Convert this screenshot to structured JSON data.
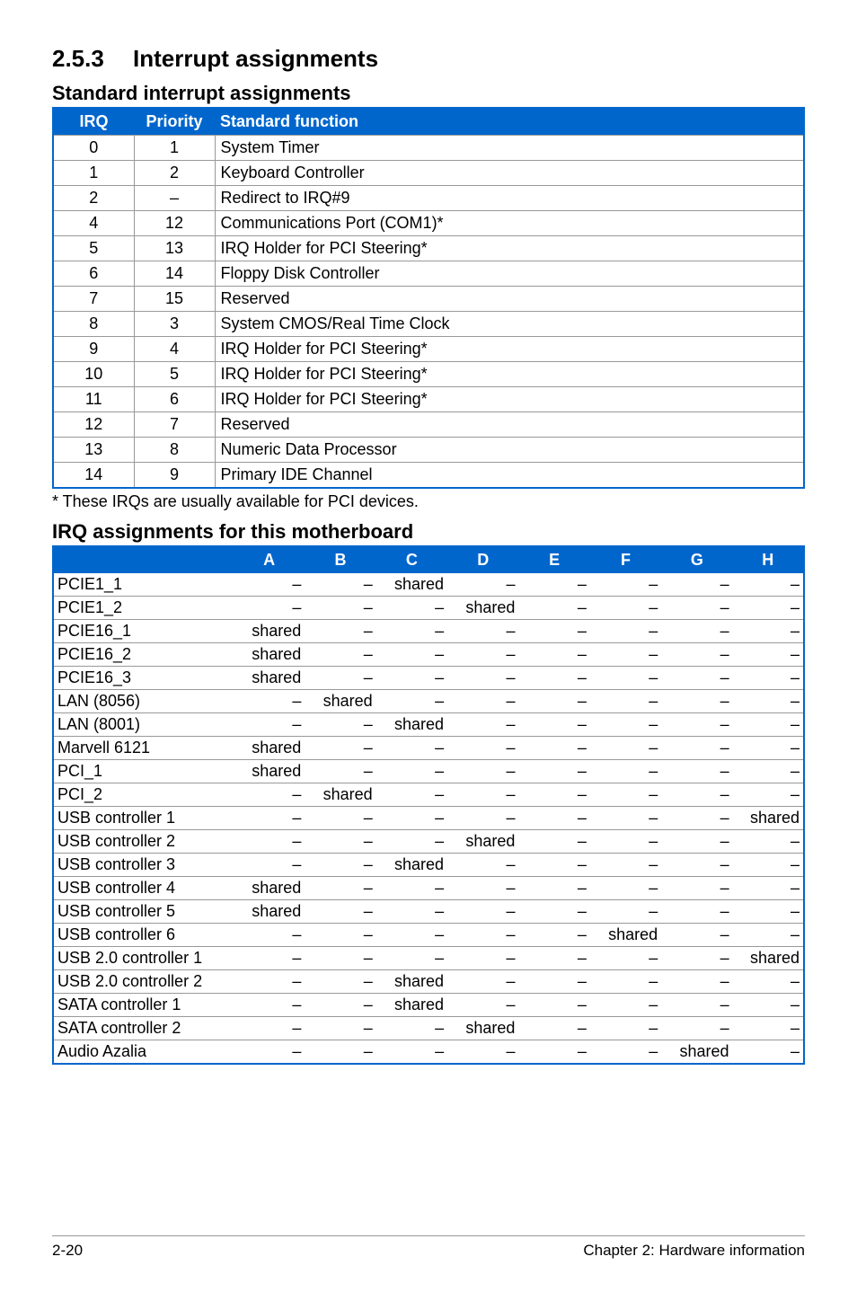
{
  "section": {
    "num": "2.5.3",
    "title": "Interrupt assignments"
  },
  "sub1": "Standard interrupt assignments",
  "t1": {
    "headers": {
      "irq": "IRQ",
      "priority": "Priority",
      "func": "Standard function"
    },
    "rows": [
      {
        "irq": "0",
        "priority": "1",
        "func": "System Timer"
      },
      {
        "irq": "1",
        "priority": "2",
        "func": "Keyboard Controller"
      },
      {
        "irq": "2",
        "priority": "–",
        "func": "Redirect to IRQ#9"
      },
      {
        "irq": "4",
        "priority": "12",
        "func": "Communications Port (COM1)*"
      },
      {
        "irq": "5",
        "priority": "13",
        "func": "IRQ Holder for PCI Steering*"
      },
      {
        "irq": "6",
        "priority": "14",
        "func": "Floppy Disk Controller"
      },
      {
        "irq": "7",
        "priority": "15",
        "func": "Reserved"
      },
      {
        "irq": "8",
        "priority": "3",
        "func": "System CMOS/Real Time Clock"
      },
      {
        "irq": "9",
        "priority": "4",
        "func": "IRQ Holder for PCI Steering*"
      },
      {
        "irq": "10",
        "priority": "5",
        "func": "IRQ Holder for PCI Steering*"
      },
      {
        "irq": "11",
        "priority": "6",
        "func": "IRQ Holder for PCI Steering*"
      },
      {
        "irq": "12",
        "priority": "7",
        "func": "Reserved"
      },
      {
        "irq": "13",
        "priority": "8",
        "func": "Numeric Data Processor"
      },
      {
        "irq": "14",
        "priority": "9",
        "func": "Primary IDE Channel"
      }
    ]
  },
  "note1": "* These IRQs are usually available for PCI devices.",
  "sub2": "IRQ assignments for this motherboard",
  "t2": {
    "cols": [
      "A",
      "B",
      "C",
      "D",
      "E",
      "F",
      "G",
      "H"
    ],
    "rows": [
      {
        "name": "PCIE1_1",
        "v": [
          "–",
          "–",
          "shared",
          "–",
          "–",
          "–",
          "–",
          "–"
        ]
      },
      {
        "name": "PCIE1_2",
        "v": [
          "–",
          "–",
          "–",
          "shared",
          "–",
          "–",
          "–",
          "–"
        ]
      },
      {
        "name": "PCIE16_1",
        "v": [
          "shared",
          "–",
          "–",
          "–",
          "–",
          "–",
          "–",
          "–"
        ]
      },
      {
        "name": "PCIE16_2",
        "v": [
          "shared",
          "–",
          "–",
          "–",
          "–",
          "–",
          "–",
          "–"
        ]
      },
      {
        "name": "PCIE16_3",
        "v": [
          "shared",
          "–",
          "–",
          "–",
          "–",
          "–",
          "–",
          "–"
        ]
      },
      {
        "name": "LAN (8056)",
        "v": [
          "–",
          "shared",
          "–",
          "–",
          "–",
          "–",
          "–",
          "–"
        ]
      },
      {
        "name": "LAN (8001)",
        "v": [
          "–",
          "–",
          "shared",
          "–",
          "–",
          "–",
          "–",
          "–"
        ]
      },
      {
        "name": "Marvell 6121",
        "v": [
          "shared",
          "–",
          "–",
          "–",
          "–",
          "–",
          "–",
          "–"
        ]
      },
      {
        "name": "PCI_1",
        "v": [
          "shared",
          "–",
          "–",
          "–",
          "–",
          "–",
          "–",
          "–"
        ]
      },
      {
        "name": "PCI_2",
        "v": [
          "–",
          "shared",
          "–",
          "–",
          "–",
          "–",
          "–",
          "–"
        ]
      },
      {
        "name": "USB controller 1",
        "v": [
          "–",
          "–",
          "–",
          "–",
          "–",
          "–",
          "–",
          "shared"
        ]
      },
      {
        "name": "USB controller 2",
        "v": [
          "–",
          "–",
          "–",
          "shared",
          "–",
          "–",
          "–",
          "–"
        ]
      },
      {
        "name": "USB controller 3",
        "v": [
          "–",
          "–",
          "shared",
          "–",
          "–",
          "–",
          "–",
          "–"
        ]
      },
      {
        "name": "USB controller 4",
        "v": [
          "shared",
          "–",
          "–",
          "–",
          "–",
          "–",
          "–",
          "–"
        ]
      },
      {
        "name": "USB controller 5",
        "v": [
          "shared",
          "–",
          "–",
          "–",
          "–",
          "–",
          "–",
          "–"
        ]
      },
      {
        "name": "USB controller 6",
        "v": [
          "–",
          "–",
          "–",
          "–",
          "–",
          "shared",
          "–",
          "–"
        ]
      },
      {
        "name": "USB 2.0 controller 1",
        "v": [
          "–",
          "–",
          "–",
          "–",
          "–",
          "–",
          "–",
          "shared"
        ]
      },
      {
        "name": "USB 2.0 controller 2",
        "v": [
          "–",
          "–",
          "shared",
          "–",
          "–",
          "–",
          "–",
          "–"
        ]
      },
      {
        "name": "SATA controller 1",
        "v": [
          "–",
          "–",
          "shared",
          "–",
          "–",
          "–",
          "–",
          "–"
        ]
      },
      {
        "name": "SATA controller 2",
        "v": [
          "–",
          "–",
          "–",
          "shared",
          "–",
          "–",
          "–",
          "–"
        ]
      },
      {
        "name": "Audio Azalia",
        "v": [
          "–",
          "–",
          "–",
          "–",
          "–",
          "–",
          "shared",
          "–"
        ]
      }
    ]
  },
  "footer": {
    "left": "2-20",
    "right": "Chapter 2: Hardware information"
  }
}
